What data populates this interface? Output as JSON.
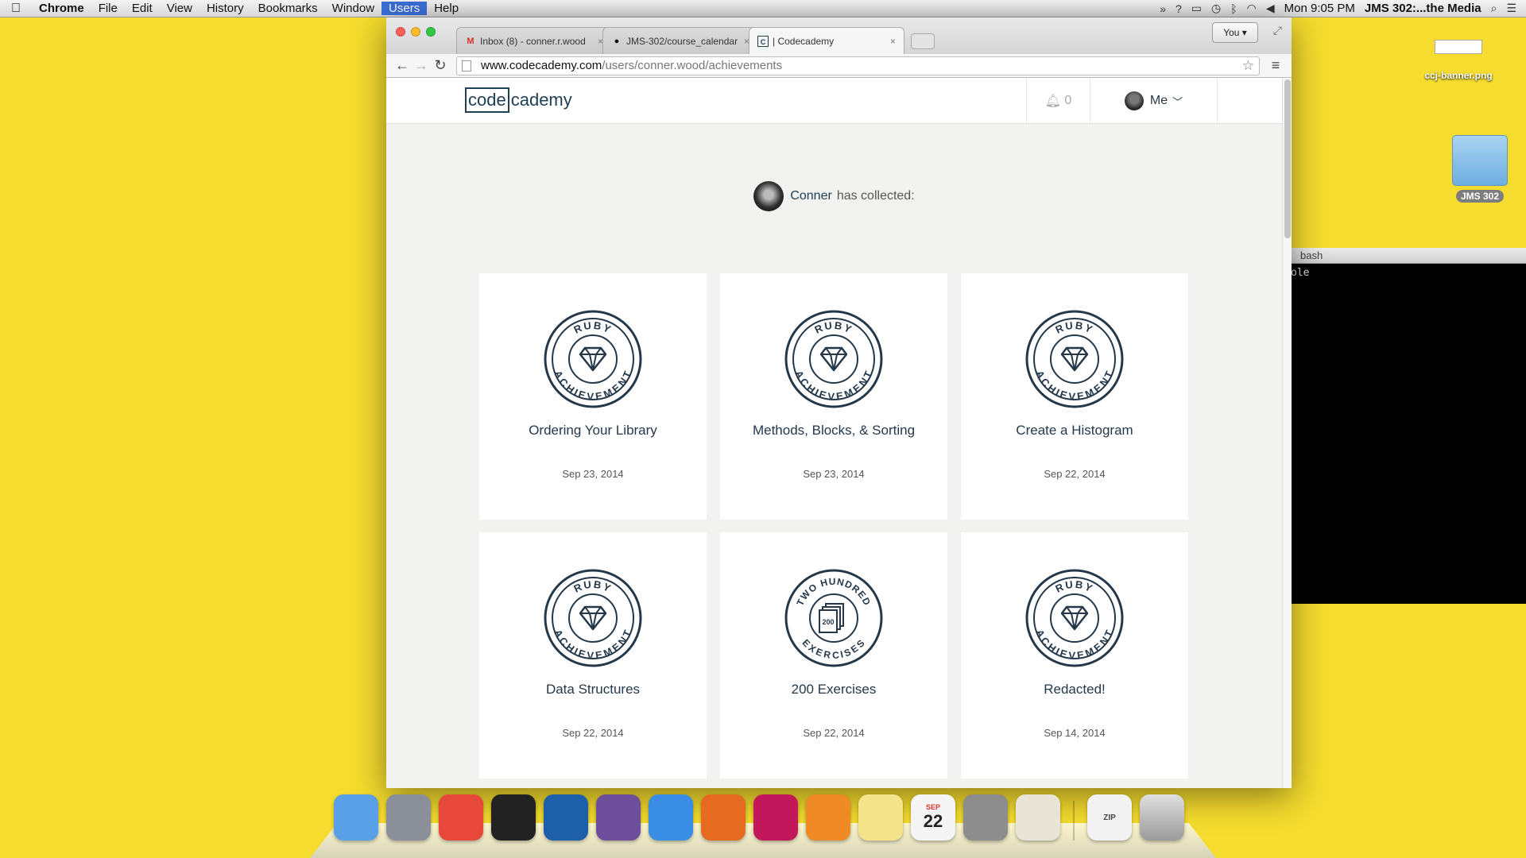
{
  "menubar": {
    "apple": "",
    "items": [
      "Chrome",
      "File",
      "Edit",
      "View",
      "History",
      "Bookmarks",
      "Window",
      "Users",
      "Help"
    ],
    "clock": "Mon 9:05 PM",
    "window_title": "JMS 302:...the Media",
    "status_icons": [
      "expand-icon",
      "help-icon",
      "airplay-icon",
      "time-machine-icon",
      "bluetooth-icon",
      "wifi-icon",
      "volume-icon",
      "search-icon",
      "list-icon"
    ]
  },
  "desktop": {
    "file_label": "ccj-banner.png",
    "folder_label": "JMS 302"
  },
  "terminal": {
    "title": "bash",
    "line": "ole"
  },
  "browser": {
    "tabs": [
      {
        "title": "Inbox (8) - conner.r.wood",
        "icon": "gmail-icon"
      },
      {
        "title": "JMS-302/course_calendar",
        "icon": "github-icon"
      },
      {
        "title": "| Codecademy",
        "icon": "codecademy-icon"
      }
    ],
    "profile": "You",
    "url_host": "www.codecademy.com",
    "url_path": "/users/conner.wood/achievements"
  },
  "site": {
    "logo_box": "code",
    "logo_rest": "cademy",
    "notif_count": "0",
    "me_label": "Me",
    "user_name": "Conner",
    "collected_suffix": "has collected:"
  },
  "achievements": [
    {
      "title": "Ordering Your Library",
      "date": "Sep 23, 2014",
      "badge_top": "RUBY",
      "badge_bottom": "ACHIEVEMENT",
      "kind": "ruby"
    },
    {
      "title": "Methods, Blocks, & Sorting",
      "date": "Sep 23, 2014",
      "badge_top": "RUBY",
      "badge_bottom": "ACHIEVEMENT",
      "kind": "ruby"
    },
    {
      "title": "Create a Histogram",
      "date": "Sep 22, 2014",
      "badge_top": "RUBY",
      "badge_bottom": "ACHIEVEMENT",
      "kind": "ruby"
    },
    {
      "title": "Data Structures",
      "date": "Sep 22, 2014",
      "badge_top": "RUBY",
      "badge_bottom": "ACHIEVEMENT",
      "kind": "ruby"
    },
    {
      "title": "200 Exercises",
      "date": "Sep 22, 2014",
      "badge_top": "TWO HUNDRED",
      "badge_bottom": "EXERCISES",
      "badge_center": "200",
      "kind": "exercises"
    },
    {
      "title": "Redacted!",
      "date": "Sep 14, 2014",
      "badge_top": "RUBY",
      "badge_bottom": "ACHIEVEMENT",
      "kind": "ruby"
    }
  ],
  "dock": {
    "apps": [
      "finder-icon",
      "launchpad-icon",
      "chrome-icon",
      "terminal-icon",
      "sourcetree-icon",
      "github-app-icon",
      "safari-icon",
      "firefox-icon",
      "rubymine-icon",
      "preferences-gear-icon",
      "stickies-icon",
      "calendar-icon",
      "system-preferences-icon",
      "textedit-icon"
    ],
    "calendar_month": "SEP",
    "calendar_day": "22",
    "zip_label": "ZIP"
  },
  "colors": {
    "desktop": "#f5dc2e",
    "brand": "#204056",
    "page_bg": "#f2f2f1"
  }
}
